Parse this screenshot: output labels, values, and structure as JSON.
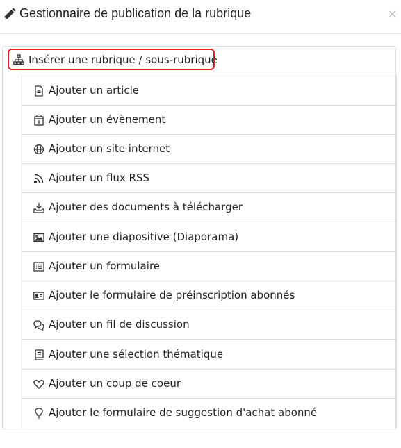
{
  "header": {
    "title": "Gestionnaire de publication de la rubrique",
    "close_label": "×",
    "icon": "pencil-icon"
  },
  "root_item": {
    "label": "Insérer une rubrique / sous-rubrique",
    "icon": "sitemap-icon",
    "highlight_color": "#e32323"
  },
  "items": [
    {
      "label": "Ajouter un article",
      "icon": "file-icon"
    },
    {
      "label": "Ajouter un évènement",
      "icon": "calendar-plus-icon"
    },
    {
      "label": "Ajouter un site internet",
      "icon": "globe-icon"
    },
    {
      "label": "Ajouter un flux RSS",
      "icon": "rss-icon"
    },
    {
      "label": "Ajouter des documents à télécharger",
      "icon": "download-tray-icon"
    },
    {
      "label": "Ajouter une diapositive (Diaporama)",
      "icon": "image-icon"
    },
    {
      "label": "Ajouter un formulaire",
      "icon": "list-alt-icon"
    },
    {
      "label": "Ajouter le formulaire de préinscription abonnés",
      "icon": "id-card-icon"
    },
    {
      "label": "Ajouter un fil de discussion",
      "icon": "comments-icon"
    },
    {
      "label": "Ajouter une sélection thématique",
      "icon": "book-icon"
    },
    {
      "label": "Ajouter un coup de coeur",
      "icon": "heart-icon"
    },
    {
      "label": "Ajouter le formulaire de suggestion d'achat abonné",
      "icon": "lightbulb-icon"
    }
  ]
}
